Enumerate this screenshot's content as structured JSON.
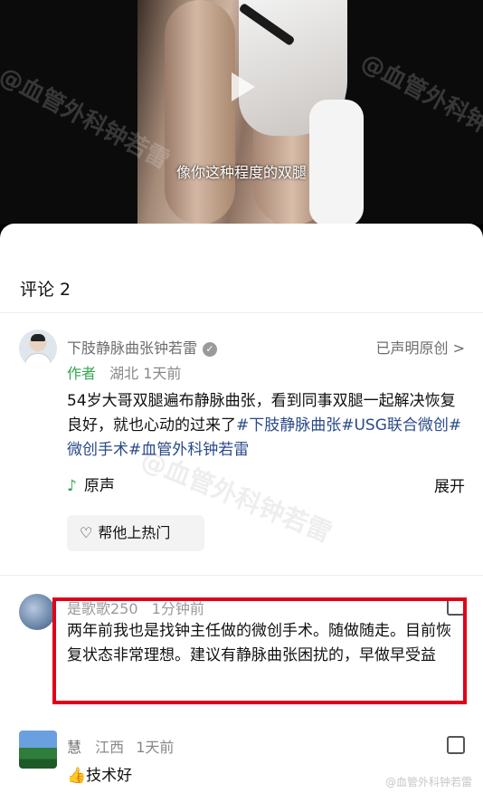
{
  "video": {
    "subtitle": "像你这种程度的双腿",
    "watermark": "@血管外科钟若雷"
  },
  "comments_panel": {
    "title": "评论 2"
  },
  "post": {
    "author_name": "下肢静脉曲张钟若雷",
    "author_tag": "作者",
    "location": "湖北",
    "time": "1天前",
    "original_label": "已声明原创 >",
    "text_plain": "54岁大哥双腿遍布静脉曲张，看到同事双腿一起解决恢复良好，就也心动的过来了",
    "hashtags": "#下肢静脉曲张#USG联合微创#微创手术#血管外科钟若雷",
    "audio_label": "原声",
    "expand_label": "展开",
    "hot_button_label": "帮他上热门"
  },
  "comments": [
    {
      "name": "是歌歌250",
      "time": "1分钟前",
      "text": "两年前我也是找钟主任做的微创手术。随做随走。目前恢复状态非常理想。建议有静脉曲张困扰的，早做早受益"
    },
    {
      "name": "慧",
      "location": "江西",
      "time": "1天前",
      "text": "👍技术好"
    }
  ],
  "footer_watermark": "@血管外科钟若雷",
  "colors": {
    "highlight_border": "#e0001a",
    "author_tag": "#2fa84f",
    "hashtag": "#2a4a8a"
  }
}
